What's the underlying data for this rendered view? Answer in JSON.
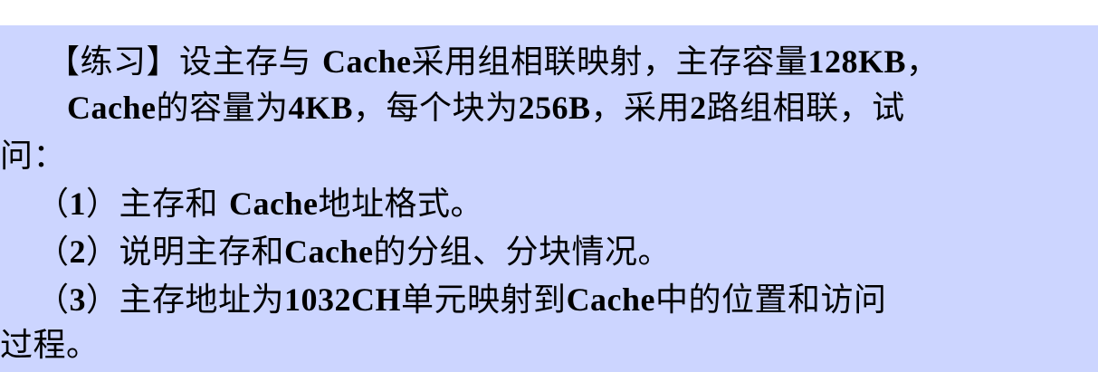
{
  "exercise": {
    "bracket_open": "【",
    "tag": "练习",
    "bracket_close": "】",
    "line1_a": "设主存与 ",
    "line1_cache": "Cache",
    "line1_b": "采用组相联映射，主存容量",
    "line1_size": "128KB",
    "line1_c": "，",
    "line2_cache": "Cache",
    "line2_a": "的容量为",
    "line2_size": "4KB",
    "line2_b": "，每个块为",
    "line2_block": "256B",
    "line2_c": "，采用",
    "line2_ways": "2",
    "line2_d": "路组相联，试",
    "line3": "问：",
    "q1_open": "（",
    "q1_num": "1",
    "q1_close": "）",
    "q1_a": "主存和 ",
    "q1_cache": "Cache",
    "q1_b": "地址格式。",
    "q2_open": "（",
    "q2_num": "2",
    "q2_close": "）",
    "q2_a": "说明主存和",
    "q2_cache": "Cache",
    "q2_b": "的分组、分块情况。",
    "q3_open": "（",
    "q3_num": "3",
    "q3_close": "）",
    "q3_a": "主存地址为",
    "q3_addr": "1032CH",
    "q3_b": "单元映射到",
    "q3_cache": "Cache",
    "q3_c": "中的位置和访问",
    "line7": "过程。"
  },
  "colors": {
    "panel_bg": "#ccd5ff",
    "text": "#000000"
  }
}
